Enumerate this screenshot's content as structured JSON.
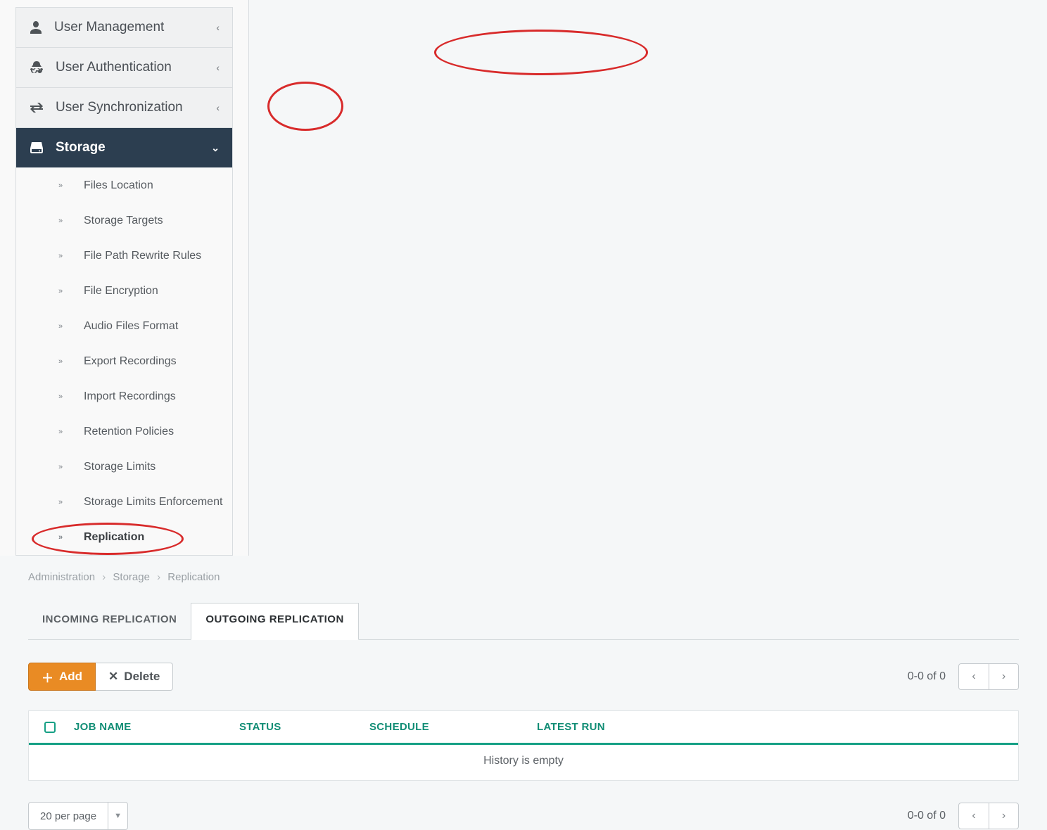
{
  "breadcrumb": [
    "Administration",
    "Storage",
    "Replication"
  ],
  "sidebar": {
    "sections": [
      {
        "label": "User Management",
        "collapsed": true
      },
      {
        "label": "User Authentication",
        "collapsed": true
      },
      {
        "label": "User Synchronization",
        "collapsed": true
      },
      {
        "label": "Storage",
        "collapsed": false
      }
    ],
    "storage_items": [
      "Files Location",
      "Storage Targets",
      "File Path Rewrite Rules",
      "File Encryption",
      "Audio Files Format",
      "Export Recordings",
      "Import Recordings",
      "Retention Policies",
      "Storage Limits",
      "Storage Limits Enforcement",
      "Replication"
    ],
    "active_item": "Replication"
  },
  "tabs": {
    "incoming": "INCOMING REPLICATION",
    "outgoing": "OUTGOING REPLICATION",
    "active": "outgoing"
  },
  "toolbar": {
    "add": "Add",
    "delete": "Delete"
  },
  "table": {
    "headers": {
      "job": "JOB NAME",
      "status": "STATUS",
      "schedule": "SCHEDULE",
      "latest": "LATEST RUN"
    },
    "empty": "History is empty"
  },
  "pager": {
    "summary": "0-0 of 0",
    "per_page": "20 per page"
  }
}
